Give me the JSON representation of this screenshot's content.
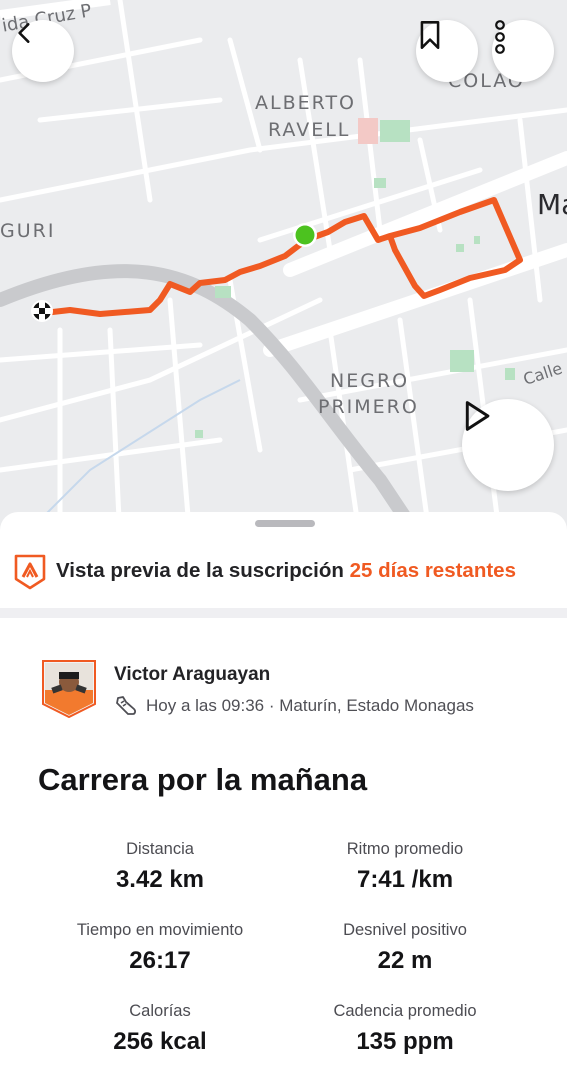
{
  "map": {
    "labels": {
      "street_top": "ida Cruz P",
      "neighborhood_1_line1": "ALBERTO",
      "neighborhood_1_line2": "RAVELL",
      "neighborhood_2": "GURI",
      "neighborhood_3_line1": "NEGRO",
      "neighborhood_3_line2": "PRIMERO",
      "city_partial": "Ma",
      "colao_partial": "COLAO",
      "street_right": "Calle"
    },
    "route_color": "#f05a22",
    "start_marker_color": "#4cc21f"
  },
  "buttons": {
    "back_icon": "chevron-left-icon",
    "bookmark_icon": "bookmark-icon",
    "more_icon": "more-vertical-icon",
    "play_icon": "play-icon"
  },
  "subscription": {
    "text": "Vista previa de la suscripción",
    "days": "25 días restantes",
    "accent": "#f05a22"
  },
  "athlete": {
    "name": "Victor Araguayan",
    "meta": "Hoy a las 09:36 · Maturín, Estado Monagas"
  },
  "activity": {
    "title": "Carrera por la mañana",
    "stats": [
      {
        "label": "Distancia",
        "value": "3.42 km"
      },
      {
        "label": "Ritmo promedio",
        "value": "7:41 /km"
      },
      {
        "label": "Tiempo en movimiento",
        "value": "26:17"
      },
      {
        "label": "Desnivel positivo",
        "value": "22 m"
      },
      {
        "label": "Calorías",
        "value": "256 kcal"
      },
      {
        "label": "Cadencia promedio",
        "value": "135 ppm"
      }
    ]
  }
}
